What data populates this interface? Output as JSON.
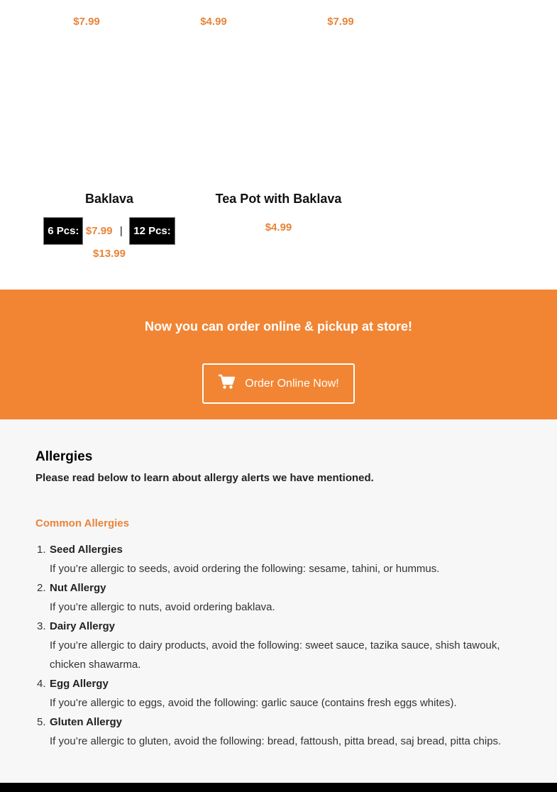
{
  "top_row": {
    "prices": [
      "$7.99",
      "$4.99",
      "$7.99"
    ]
  },
  "products": [
    {
      "title": "Baklava",
      "size1_label": "6 Pcs:",
      "size1_price": "$7.99",
      "separator": "|",
      "size2_label": "12 Pcs:",
      "size2_price": "$13.99"
    },
    {
      "title": "Tea Pot with Baklava",
      "price": "$4.99"
    }
  ],
  "promo": {
    "title": "Now you can order online & pickup at store!",
    "button_label": "Order Online Now!",
    "button_icon": "shopping-cart-icon",
    "background": "#f28533"
  },
  "allergies": {
    "heading": "Allergies",
    "intro": "Please read below to learn about allergy alerts we have mentioned.",
    "subheading": "Common Allergies",
    "items": [
      {
        "num": "1.",
        "name": "Seed Allergies",
        "desc": "If you’re allergic to seeds, avoid ordering the following: sesame, tahini, or hummus."
      },
      {
        "num": "2.",
        "name": "Nut Allergy",
        "desc": "If you’re allergic to nuts, avoid ordering baklava."
      },
      {
        "num": "3.",
        "name": "Dairy Allergy",
        "desc": "If you’re allergic to dairy products, avoid the following: sweet sauce, tazika sauce, shish tawouk, chicken shawarma."
      },
      {
        "num": "4.",
        "name": "Egg Allergy",
        "desc": "If you’re allergic to eggs, avoid the following: garlic sauce (contains fresh eggs whites)."
      },
      {
        "num": "5.",
        "name": "Gluten Allergy",
        "desc": "If you’re allergic to gluten, avoid the following: bread, fattoush, pitta bread, saj bread, pitta chips."
      }
    ]
  },
  "colors": {
    "accent": "#e8843a",
    "allergy_bg": "#f7f7f8",
    "footer": "#000000"
  }
}
